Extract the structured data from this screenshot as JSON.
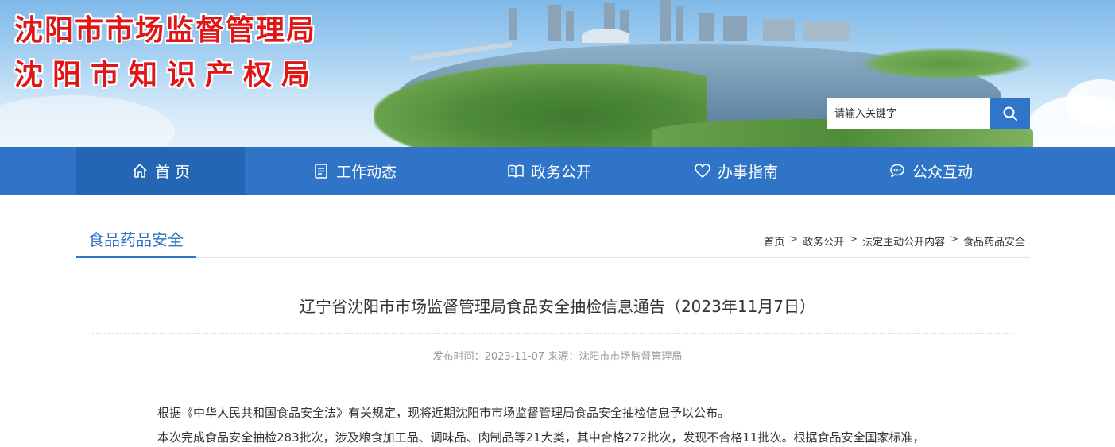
{
  "header": {
    "title_line1": "沈阳市市场监督管理局",
    "title_line2": "沈阳市知识产权局",
    "title_color": "#e01616"
  },
  "search": {
    "placeholder": "请输入关键字",
    "button_icon": "search-icon"
  },
  "nav": {
    "color": "#2f74c6",
    "items": [
      {
        "label": "首 页",
        "icon": "home-icon"
      },
      {
        "label": "工作动态",
        "icon": "document-icon"
      },
      {
        "label": "政务公开",
        "icon": "book-icon"
      },
      {
        "label": "办事指南",
        "icon": "heart-icon"
      },
      {
        "label": "公众互动",
        "icon": "chat-icon"
      }
    ]
  },
  "section": {
    "title": "食品药品安全"
  },
  "breadcrumb": {
    "items": [
      "首页",
      "政务公开",
      "法定主动公开内容",
      "食品药品安全"
    ],
    "separator": ">"
  },
  "article": {
    "title": "辽宁省沈阳市市场监督管理局食品安全抽检信息通告（2023年11月7日）",
    "meta": "发布时间：2023-11-07 来源：沈阳市市场监督管理局",
    "paragraphs": [
      "根据《中华人民共和国食品安全法》有关规定，现将近期沈阳市市场监督管理局食品安全抽检信息予以公布。",
      "本次完成食品安全抽检283批次，涉及粮食加工品、调味品、肉制品等21大类，其中合格272批次，发现不合格11批次。根据食品安全国家标准，"
    ]
  }
}
